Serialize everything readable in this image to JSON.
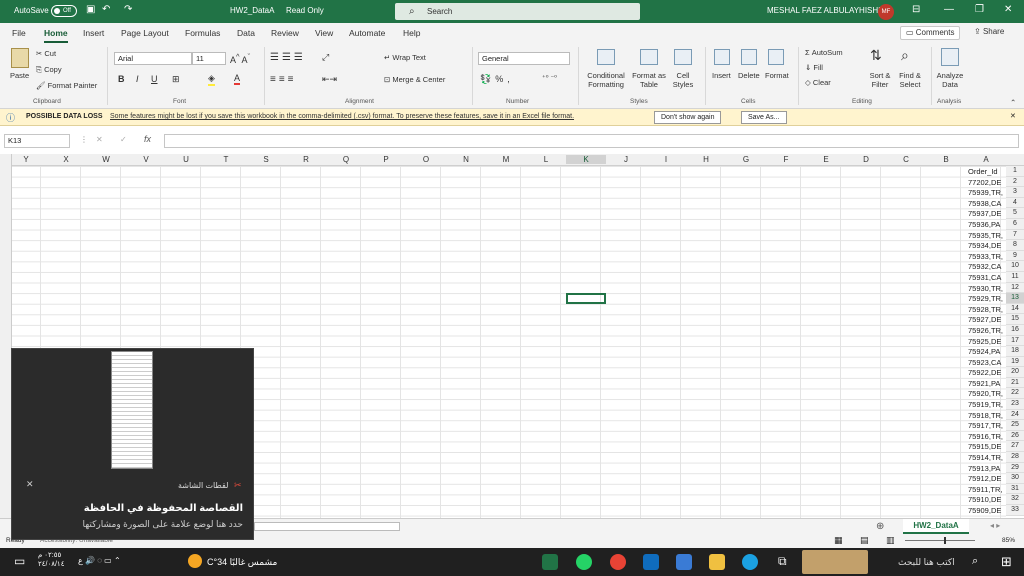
{
  "titlebar": {
    "autosave_label": "AutoSave",
    "autosave_state": "Off",
    "doc_title": "HW2_DataA",
    "mode": "Read Only",
    "search_placeholder": "Search",
    "user_name": "MESHAL FAEZ ALBULAYHISHI",
    "user_initials": "MF"
  },
  "menu": {
    "tabs": [
      "File",
      "Home",
      "Insert",
      "Page Layout",
      "Formulas",
      "Data",
      "Review",
      "View",
      "Automate",
      "Help"
    ],
    "comments": "Comments",
    "share": "Share"
  },
  "ribbon": {
    "paste": "Paste",
    "cut": "Cut",
    "copy": "Copy",
    "format_painter": "Format Painter",
    "font_name": "Arial",
    "font_size": "11",
    "wrap_text": "Wrap Text",
    "merge_center": "Merge & Center",
    "number_format": "General",
    "conditional_formatting": "Conditional Formatting",
    "format_as_table": "Format as Table",
    "cell_styles": "Cell Styles",
    "insert": "Insert",
    "delete": "Delete",
    "format": "Format",
    "autosum": "AutoSum",
    "fill": "Fill",
    "clear": "Clear",
    "sort_filter": "Sort & Filter",
    "find_select": "Find & Select",
    "analyze_data": "Analyze Data",
    "groups": [
      "Clipboard",
      "Font",
      "Alignment",
      "Number",
      "Styles",
      "Cells",
      "Editing",
      "Analysis"
    ]
  },
  "warning": {
    "title": "POSSIBLE DATA LOSS",
    "message": "Some features might be lost if you save this workbook in the comma-delimited (.csv) format. To preserve these features, save it in an Excel file format.",
    "dont_show": "Don't show again",
    "save_as": "Save As..."
  },
  "formula": {
    "name_box": "K13",
    "fx": "fx",
    "value": ""
  },
  "columns": [
    "Y",
    "X",
    "W",
    "V",
    "U",
    "T",
    "S",
    "R",
    "Q",
    "P",
    "O",
    "N",
    "M",
    "L",
    "K",
    "J",
    "I",
    "H",
    "G",
    "F",
    "E",
    "D",
    "C",
    "B",
    "A"
  ],
  "rows": [
    {
      "n": "1",
      "v": "Order_Id"
    },
    {
      "n": "2",
      "v": "77202,DE"
    },
    {
      "n": "3",
      "v": "75939,TR,"
    },
    {
      "n": "4",
      "v": "75938,CA"
    },
    {
      "n": "5",
      "v": "75937,DE"
    },
    {
      "n": "6",
      "v": "75936,PA"
    },
    {
      "n": "7",
      "v": "75935,TR,"
    },
    {
      "n": "8",
      "v": "75934,DE"
    },
    {
      "n": "9",
      "v": "75933,TR,"
    },
    {
      "n": "10",
      "v": "75932,CA"
    },
    {
      "n": "11",
      "v": "75931,CA"
    },
    {
      "n": "12",
      "v": "75930,TR,"
    },
    {
      "n": "13",
      "v": "75929,TR,"
    },
    {
      "n": "14",
      "v": "75928,TR,"
    },
    {
      "n": "15",
      "v": "75927,DE"
    },
    {
      "n": "16",
      "v": "75926,TR,"
    },
    {
      "n": "17",
      "v": "75925,DE"
    },
    {
      "n": "18",
      "v": "75924,PA"
    },
    {
      "n": "19",
      "v": "75923,CA"
    },
    {
      "n": "20",
      "v": "75922,DE"
    },
    {
      "n": "21",
      "v": "75921,PA"
    },
    {
      "n": "22",
      "v": "75920,TR,"
    },
    {
      "n": "23",
      "v": "75919,TR,"
    },
    {
      "n": "24",
      "v": "75918,TR,"
    },
    {
      "n": "25",
      "v": "75917,TR,"
    },
    {
      "n": "26",
      "v": "75916,TR,"
    },
    {
      "n": "27",
      "v": "75915,DE"
    },
    {
      "n": "28",
      "v": "75914,TR,"
    },
    {
      "n": "29",
      "v": "75913,PA"
    },
    {
      "n": "30",
      "v": "75912,DE"
    },
    {
      "n": "31",
      "v": "75911,TR,"
    },
    {
      "n": "32",
      "v": "75910,DE"
    },
    {
      "n": "33",
      "v": "75909,DE"
    }
  ],
  "sheet": {
    "tab": "HW2_DataA",
    "status_ready": "Ready",
    "accessibility": "Accessibility: Unavailable",
    "zoom": "85%"
  },
  "notification": {
    "app": "لقطات الشاشة",
    "title": "القصاصة المحفوظة في الحافظة",
    "body": "حدد هنا لوضع علامة على الصورة ومشاركتها"
  },
  "taskbar": {
    "search": "اكتب هنا للبحث",
    "weather": "مشمس غالبًا 34°C",
    "time": "٠٢:٥٥ م",
    "date": "٢٤/٠٨/١٤"
  },
  "colors": {
    "excel_green": "#217346",
    "warning_bg": "#fff4ce",
    "taskbar": "#202020"
  }
}
